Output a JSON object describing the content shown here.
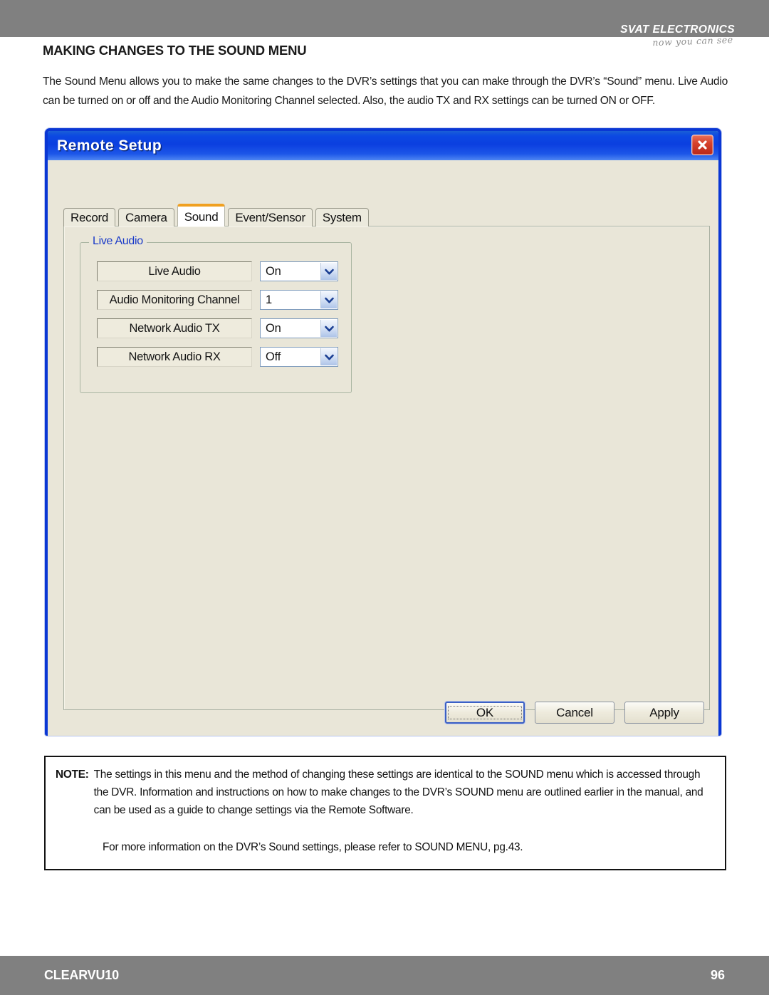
{
  "header": {
    "brand_name": "SVAT ELECTRONICS",
    "brand_tagline": "now you can see",
    "band_color": "#808080"
  },
  "page": {
    "section_title": "MAKING CHANGES TO THE SOUND MENU",
    "intro": "The Sound Menu allows you to make the same changes to the DVR’s settings that you can make through the DVR’s “Sound” menu.  Live Audio can be turned on or off and the Audio Monitoring Channel selected.  Also, the audio TX and RX settings can be turned ON or OFF."
  },
  "dialog": {
    "title": "Remote Setup",
    "close_icon": "close-icon",
    "titlebar_color": "#0b3fe0",
    "accent_color": "#f0a020",
    "tabs": [
      {
        "label": "Record",
        "active": false
      },
      {
        "label": "Camera",
        "active": false
      },
      {
        "label": "Sound",
        "active": true
      },
      {
        "label": "Event/Sensor",
        "active": false
      },
      {
        "label": "System",
        "active": false
      }
    ],
    "group": {
      "legend": "Live Audio",
      "legend_color": "#1738c8",
      "rows": [
        {
          "label": "Live Audio",
          "value": "On",
          "arrow_icon": "chevron-down-icon"
        },
        {
          "label": "Audio Monitoring Channel",
          "value": "1",
          "arrow_icon": "chevron-down-icon"
        },
        {
          "label": "Network Audio TX",
          "value": "On",
          "arrow_icon": "chevron-down-icon"
        },
        {
          "label": "Network Audio RX",
          "value": "Off",
          "arrow_icon": "chevron-down-icon"
        }
      ]
    },
    "buttons": {
      "ok": "OK",
      "cancel": "Cancel",
      "apply": "Apply"
    }
  },
  "note": {
    "label": "NOTE:",
    "body": "The settings in this menu and the method of changing these settings are identical to the SOUND menu which is accessed through the DVR.  Information and instructions on how to make changes to the DVR’s SOUND menu are outlined earlier in the manual, and can be used as a guide to change settings via the Remote Software.",
    "extra": "For more information on the DVR’s Sound settings, please refer to SOUND MENU, pg.43."
  },
  "footer": {
    "model": "CLEARVU10",
    "page_number": "96"
  }
}
